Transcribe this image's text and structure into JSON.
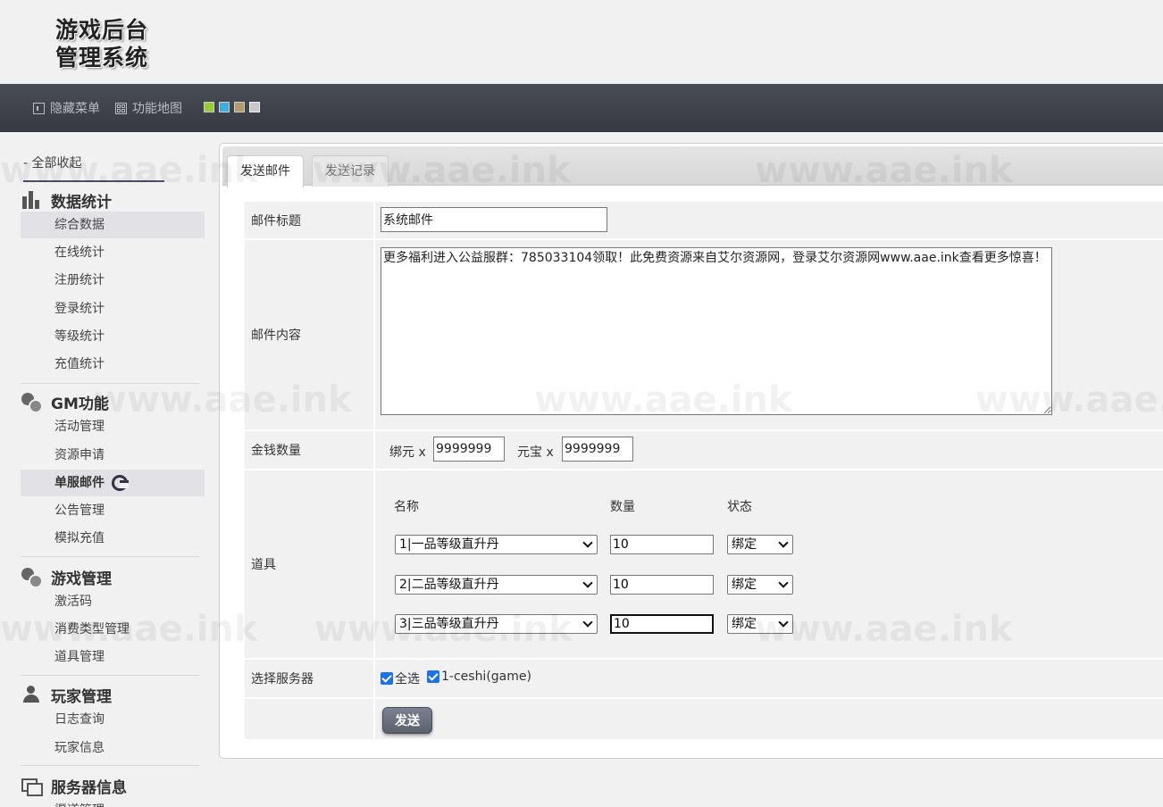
{
  "header": {
    "logo_line1": "游戏后台",
    "logo_line2": "管理系统"
  },
  "topbar": {
    "hide_menu": "隐藏菜单",
    "function_map": "功能地图",
    "theme_swatches": [
      "#9acd32",
      "#3aaee0",
      "#b39b6b",
      "#c8c8c8"
    ]
  },
  "sidebar": {
    "collapse_all": "- 全部收起",
    "groups": [
      {
        "title": "数据统计",
        "icon": "bar-chart-icon",
        "items": [
          "综合数据",
          "在线统计",
          "注册统计",
          "登录统计",
          "等级统计",
          "充值统计"
        ]
      },
      {
        "title": "GM功能",
        "icon": "chat-bubbles-icon",
        "items": [
          "活动管理",
          "资源申请",
          "单服邮件",
          "公告管理",
          "模拟充值"
        ]
      },
      {
        "title": "游戏管理",
        "icon": "chat-bubbles-icon",
        "items": [
          "激活码",
          "消费类型管理",
          "道具管理"
        ]
      },
      {
        "title": "玩家管理",
        "icon": "user-icon",
        "items": [
          "日志查询",
          "玩家信息"
        ]
      },
      {
        "title": "服务器信息",
        "icon": "server-icon",
        "items": [
          "渠道管理"
        ]
      }
    ]
  },
  "tabs": {
    "active": "发送邮件",
    "inactive": "发送记录"
  },
  "form": {
    "title_label": "邮件标题",
    "title_value": "系统邮件",
    "content_label": "邮件内容",
    "content_value": "更多福利进入公益服群：785033104领取！此免费资源来自艾尔资源网，登录艾尔资源网www.aae.ink查看更多惊喜！",
    "money_label": "金钱数量",
    "bind_yuan_label": "绑元 x",
    "bind_yuan_value": "9999999",
    "yuanbao_label": "元宝 x",
    "yuanbao_value": "9999999",
    "items_label": "道具",
    "col_name": "名称",
    "col_qty": "数量",
    "col_status": "状态",
    "items": [
      {
        "name": "1|一品等级直升丹",
        "qty": "10",
        "status": "绑定"
      },
      {
        "name": "2|二品等级直升丹",
        "qty": "10",
        "status": "绑定"
      },
      {
        "name": "3|三品等级直升丹",
        "qty": "10",
        "status": "绑定"
      }
    ],
    "server_label": "选择服务器",
    "select_all": "全选",
    "server_option": "1-ceshi(game)",
    "send_button": "发送"
  },
  "watermark_text": "www.aae.ink"
}
